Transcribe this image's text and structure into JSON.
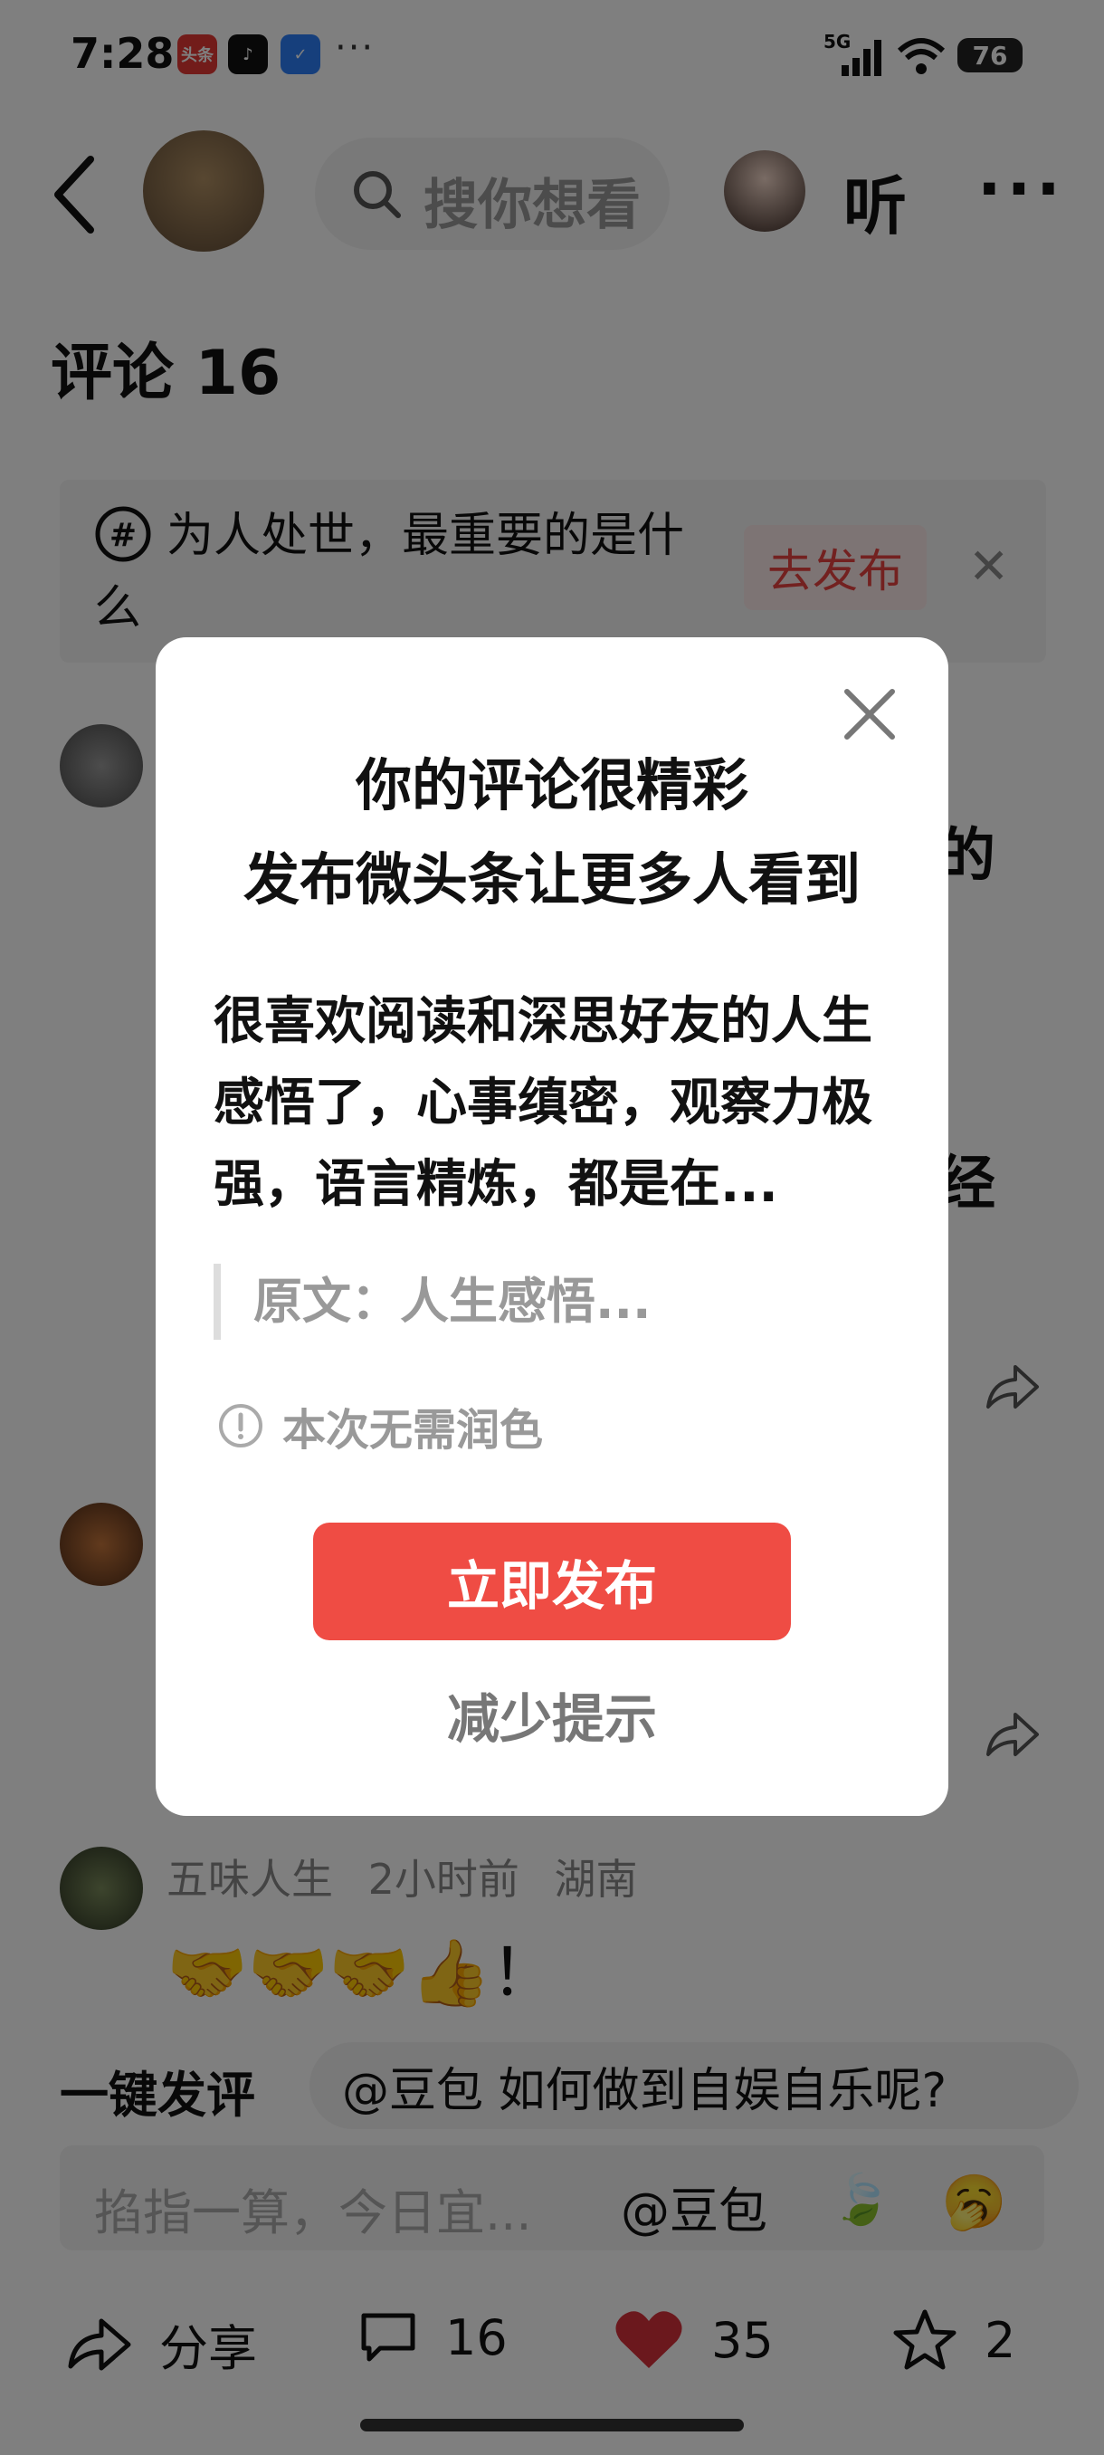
{
  "status_bar": {
    "time": "7:28",
    "apps": [
      "toutiao-icon",
      "tiktok-icon",
      "app-icon"
    ],
    "more": "···",
    "network": "5G",
    "battery": "76"
  },
  "header": {
    "search_placeholder": "搜你想看",
    "listen_label": "听",
    "more_label": "···"
  },
  "comments": {
    "title": "评论 16"
  },
  "topic": {
    "text": "为人处世，最重要的是什么",
    "cta": "去发布"
  },
  "peek": {
    "right_char_1": "的",
    "right_char_2": "经"
  },
  "comment3": {
    "author": "五味人生",
    "time": "2小时前",
    "location": "湖南",
    "content": "🤝🤝🤝👍！"
  },
  "quick_reply": {
    "label": "一键发评",
    "suggestion": "@豆包 如何做到自娱自乐呢?"
  },
  "input": {
    "placeholder": "掐指一算，今日宜...",
    "mention": "@豆包",
    "leaf_emoji": "🍃",
    "face_emoji": "🥱"
  },
  "bottom_bar": {
    "share_label": "分享",
    "comment_count": "16",
    "like_count": "35",
    "favorite_count": "2"
  },
  "modal": {
    "title_line1": "你的评论很精彩",
    "title_line2": "发布微头条让更多人看到",
    "body": "很喜欢阅读和深思好友的人生感悟了，心事缜密，观察力极强，语言精炼，都是在...",
    "quote": "原文：人生感悟...",
    "note": "本次无需润色",
    "primary_button": "立即发布",
    "secondary_button": "减少提示"
  },
  "colors": {
    "accent": "#ef4c44",
    "like": "#d7303a",
    "overlay": "rgba(0,0,0,0.5)"
  }
}
